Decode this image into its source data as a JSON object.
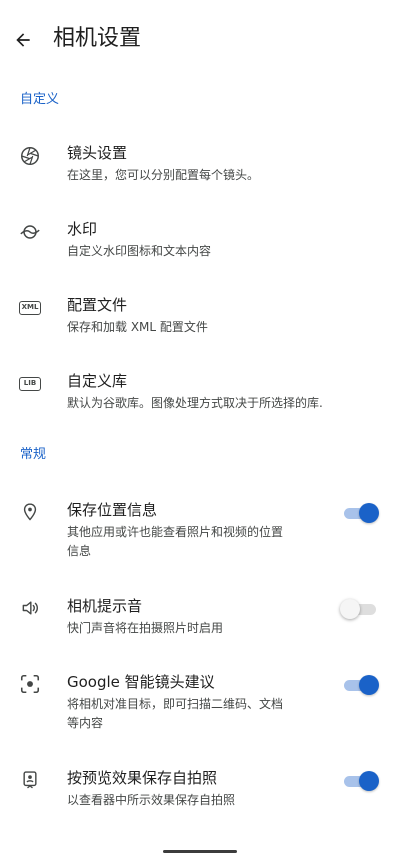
{
  "header": {
    "title": "相机设置",
    "back_icon": "arrow-left-icon"
  },
  "sections": {
    "custom": "自定义",
    "general": "常规"
  },
  "custom_items": [
    {
      "icon": "lens-aperture-icon",
      "title": "镜头设置",
      "subtitle": "在这里，您可以分别配置每个镜头。"
    },
    {
      "icon": "watermark-icon",
      "title": "水印",
      "subtitle": "自定义水印图标和文本内容"
    },
    {
      "icon": "xml-file-icon",
      "icon_text": "XML",
      "title": "配置文件",
      "subtitle": "保存和加载 XML 配置文件"
    },
    {
      "icon": "library-icon",
      "icon_text": "LIB",
      "title": "自定义库",
      "subtitle": "默认为谷歌库。图像处理方式取决于所选择的库."
    }
  ],
  "general_items": [
    {
      "icon": "location-pin-icon",
      "title": "保存位置信息",
      "subtitle_line1": "其他应用或许也能查看照片和视频的位置",
      "subtitle_line2": "信息",
      "switch_on": true
    },
    {
      "icon": "volume-icon",
      "title": "相机提示音",
      "subtitle_line1": "快门声音将在拍摄照片时启用",
      "switch_on": false
    },
    {
      "icon": "lens-suggestion-icon",
      "title": "Google 智能镜头建议",
      "subtitle_line1": "将相机对准目标，即可扫描二维码、文档",
      "subtitle_line2": "等内容",
      "switch_on": true
    },
    {
      "icon": "selfie-icon",
      "title": "按预览效果保存自拍照",
      "subtitle_line1": "以查看器中所示效果保存自拍照",
      "switch_on": true
    }
  ],
  "colors": {
    "accent": "#1a62c8",
    "text_primary": "#1f1f1f",
    "text_secondary": "#444746"
  }
}
